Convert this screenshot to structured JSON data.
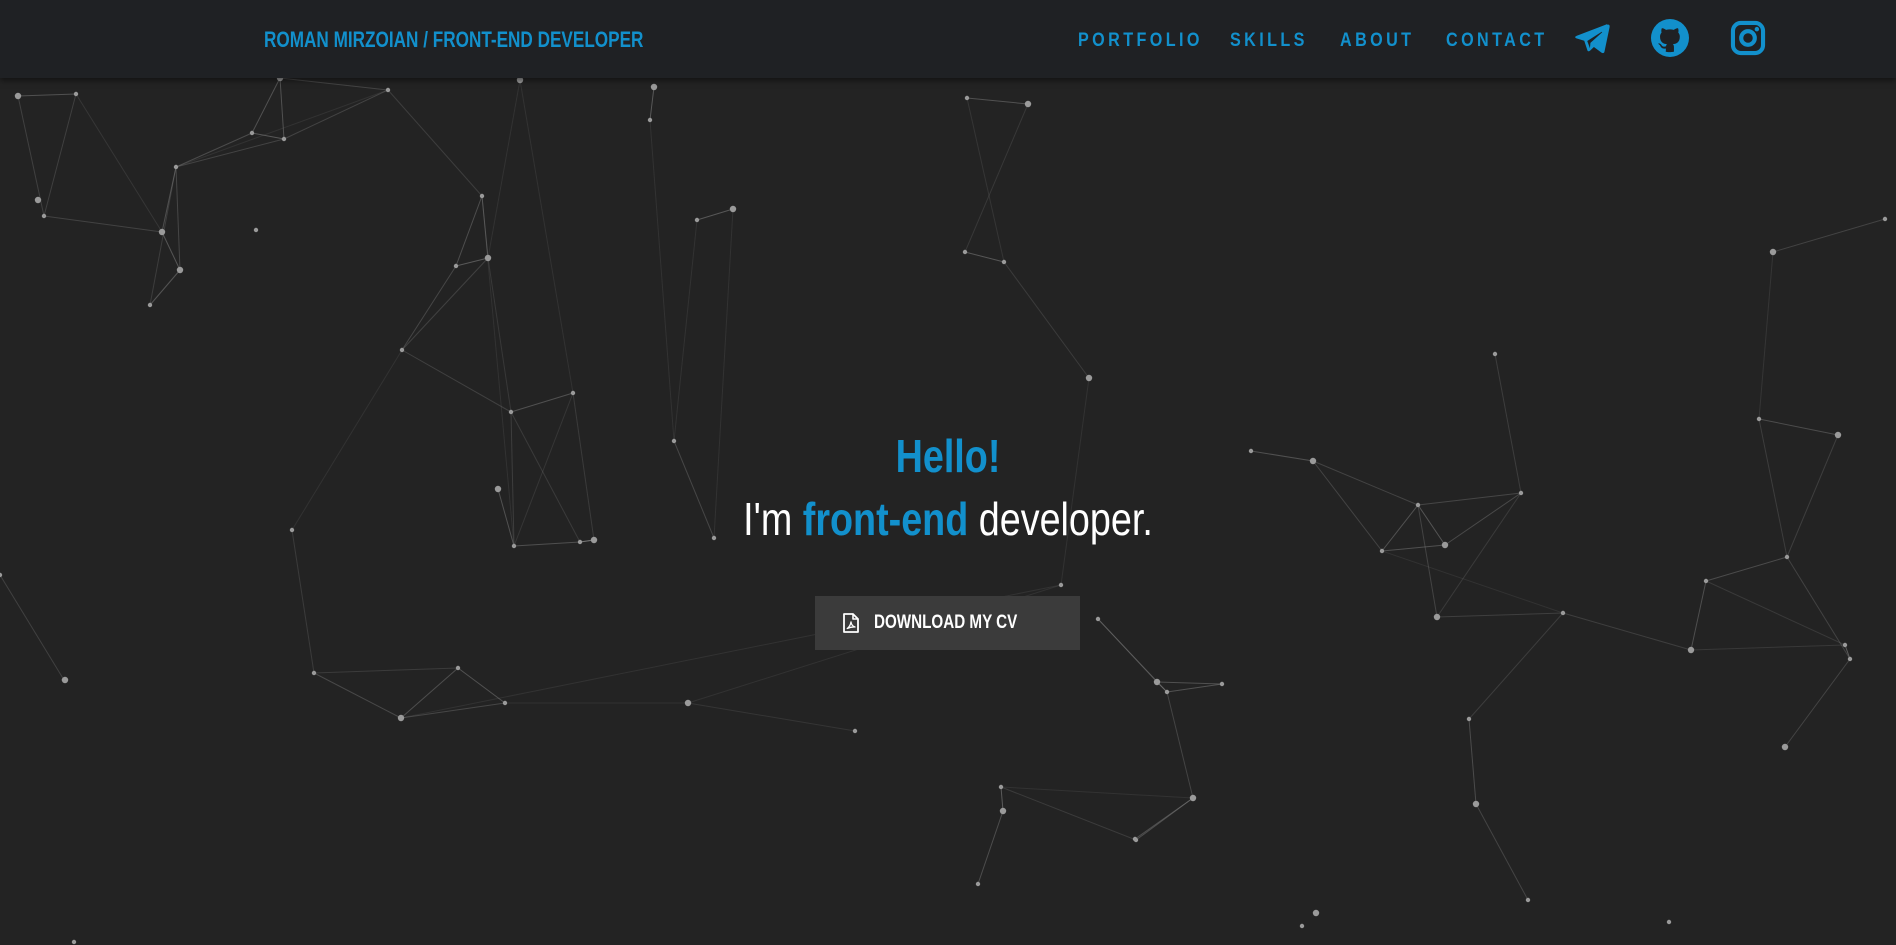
{
  "navbar": {
    "brand": "ROMAN MIRZOIAN / FRONT-END DEVELOPER",
    "links": [
      "PORTFOLIO",
      "SKILLS",
      "ABOUT",
      "CONTACT"
    ],
    "social_icons": [
      "telegram-icon",
      "github-icon",
      "instagram-icon"
    ]
  },
  "hero": {
    "greeting": "Hello!",
    "intro_prefix": "I'm",
    "intro_accent": "front-end",
    "intro_suffix": "developer.",
    "cv_button_label": "DOWNLOAD MY CV",
    "cv_button_icon": "file-pdf-icon"
  },
  "colors": {
    "background": "#232323",
    "navbar": "#1f2124",
    "accent": "#1290cc",
    "button": "#3b3b3b",
    "particle": "#8a8a8a"
  }
}
